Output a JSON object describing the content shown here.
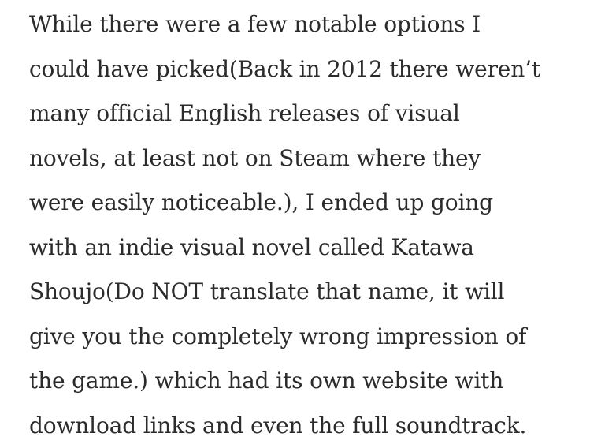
{
  "article": {
    "lines": [
      "While there were a few notable options I",
      "could have picked(Back in 2012 there weren’t",
      "many official English releases of visual",
      "novels, at least not on Steam where they",
      "were easily noticeable.), I ended up going",
      "with an indie visual novel called Katawa",
      "Shoujo(Do NOT translate that name, it will",
      "give you the completely wrong impression of",
      "the game.) which had its own website with",
      "download links and even the full soundtrack."
    ]
  },
  "colors": {
    "text": "#2b2b2b",
    "background": "#ffffff"
  }
}
